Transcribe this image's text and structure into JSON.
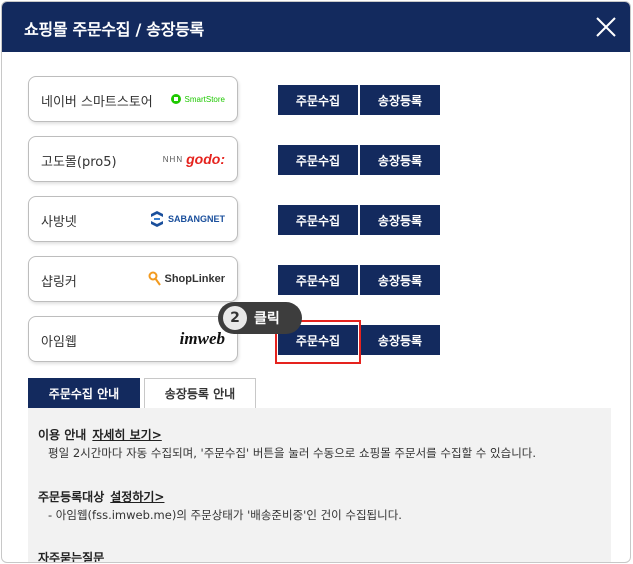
{
  "dialog": {
    "title": "쇼핑몰 주문수집 / 송장등록"
  },
  "buttons": {
    "collect": "주문수집",
    "ship": "송장등록"
  },
  "malls": [
    {
      "name": "네이버 스마트스토어",
      "logo_text": "SmartStore",
      "logo_color": "#1ec800"
    },
    {
      "name": "고도몰(pro5)",
      "logo_text": "godo:",
      "logo_prefix": "NHN",
      "logo_color": "#e5231e"
    },
    {
      "name": "사방넷",
      "logo_text": "SABANGNET",
      "logo_color": "#1a4f9c"
    },
    {
      "name": "샵링커",
      "logo_text": "ShopLinker",
      "logo_color": "#f29a1f"
    },
    {
      "name": "아임웹",
      "logo_text": "imweb",
      "logo_color": "#111111"
    }
  ],
  "callout": {
    "number": "2",
    "text": "클릭"
  },
  "tabs": {
    "collect_guide": "주문수집 안내",
    "ship_guide": "송장등록 안내"
  },
  "info": {
    "usage_title": "이용 안내",
    "usage_link": "자세히 보기>",
    "usage_text": "평일 2시간마다 자동 수집되며, '주문수집' 버튼을 눌러 수동으로 쇼핑몰 주문서를 수집할 수 있습니다.",
    "target_title": "주문등록대상",
    "target_link": "설정하기>",
    "target_text": "- 아임웹(fss.imweb.me)의 주문상태가 '배송준비중'인 건이 수집됩니다.",
    "faq_title": "자주묻는질문"
  },
  "colors": {
    "primary": "#132a5e",
    "highlight": "#e5231e"
  }
}
